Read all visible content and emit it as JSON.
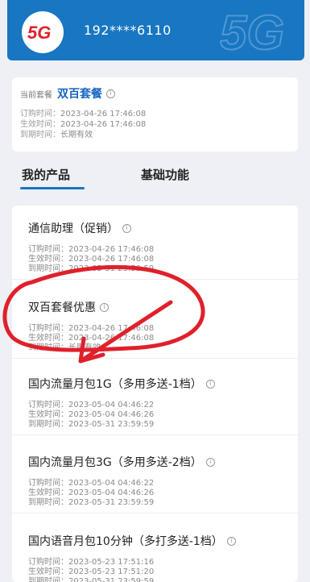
{
  "header": {
    "logo_text": "5G",
    "phone": "192****6110",
    "watermark": "5G",
    "brand_color": "#1876c2"
  },
  "plan": {
    "label": "当前套餐",
    "name": "双百套餐",
    "order_label": "订购时间：",
    "order_time": "2023-04-26 17:46:08",
    "effective_label": "生效时间：",
    "effective_time": "2023-04-26 17:46:08",
    "expire_label": "到期时间：",
    "expire_time": "长期有效"
  },
  "tabs": [
    {
      "label": "我的产品"
    },
    {
      "label": "基础功能"
    }
  ],
  "products": [
    {
      "title": "通信助理（促销）",
      "order": "订购时间：2023-04-26 17:46:08",
      "effective": "生效时间：2023-04-26 17:46:08",
      "expire": "到期时间：2023-05-31 23:59:59"
    },
    {
      "title": "双百套餐优惠",
      "order": "订购时间：2023-04-26 17:46:08",
      "effective": "生效时间：2023-04-26 17:46:08",
      "expire": "到期时间：长期有效"
    },
    {
      "title": "国内流量月包1G（多用多送-1档）",
      "order": "订购时间：2023-05-04 04:46:22",
      "effective": "生效时间：2023-05-04 04:46:26",
      "expire": "到期时间：2023-05-31 23:59:59"
    },
    {
      "title": "国内流量月包3G（多用多送-2档）",
      "order": "订购时间：2023-05-04 04:46:22",
      "effective": "生效时间：2023-05-04 04:46:26",
      "expire": "到期时间：2023-05-31 23:59:59"
    },
    {
      "title": "国内语音月包10分钟（多打多送-1档）",
      "order": "订购时间：2023-05-23 17:51:16",
      "effective": "生效时间：2023-05-23 17:51:20",
      "expire": "到期时间：2023-05-31 23:59:59"
    }
  ],
  "annotation_color": "#e0202a"
}
